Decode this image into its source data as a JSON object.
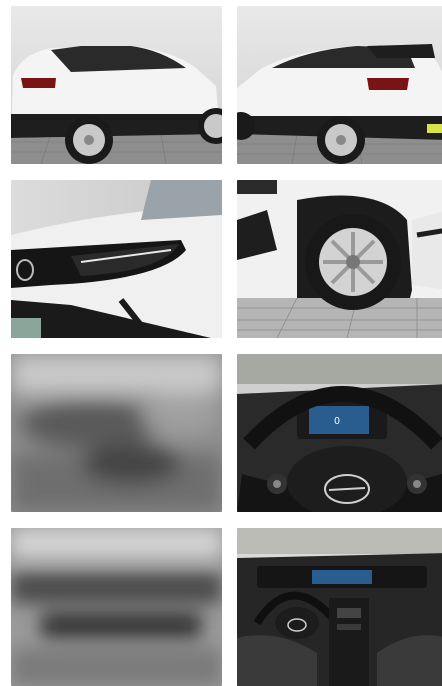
{
  "gallery": {
    "photos": [
      {
        "subject": "rear-left-exterior",
        "blurred": false
      },
      {
        "subject": "rear-right-exterior",
        "blurred": false
      },
      {
        "subject": "headlight-closeup",
        "blurred": false
      },
      {
        "subject": "wheel-closeup",
        "blurred": false
      },
      {
        "subject": "blurred-photo",
        "blurred": true
      },
      {
        "subject": "steering-wheel",
        "blurred": false
      },
      {
        "subject": "blurred-photo",
        "blurred": true
      },
      {
        "subject": "dashboard-interior",
        "blurred": false
      }
    ],
    "colors": {
      "body_white": "#f2f2f2",
      "trim_black": "#1e1e1e",
      "sky": "#dcdcdc",
      "pavement": "#9a9a9a",
      "interior_dark": "#2a2a2a",
      "screen_blue": "#2a5d8f"
    }
  }
}
